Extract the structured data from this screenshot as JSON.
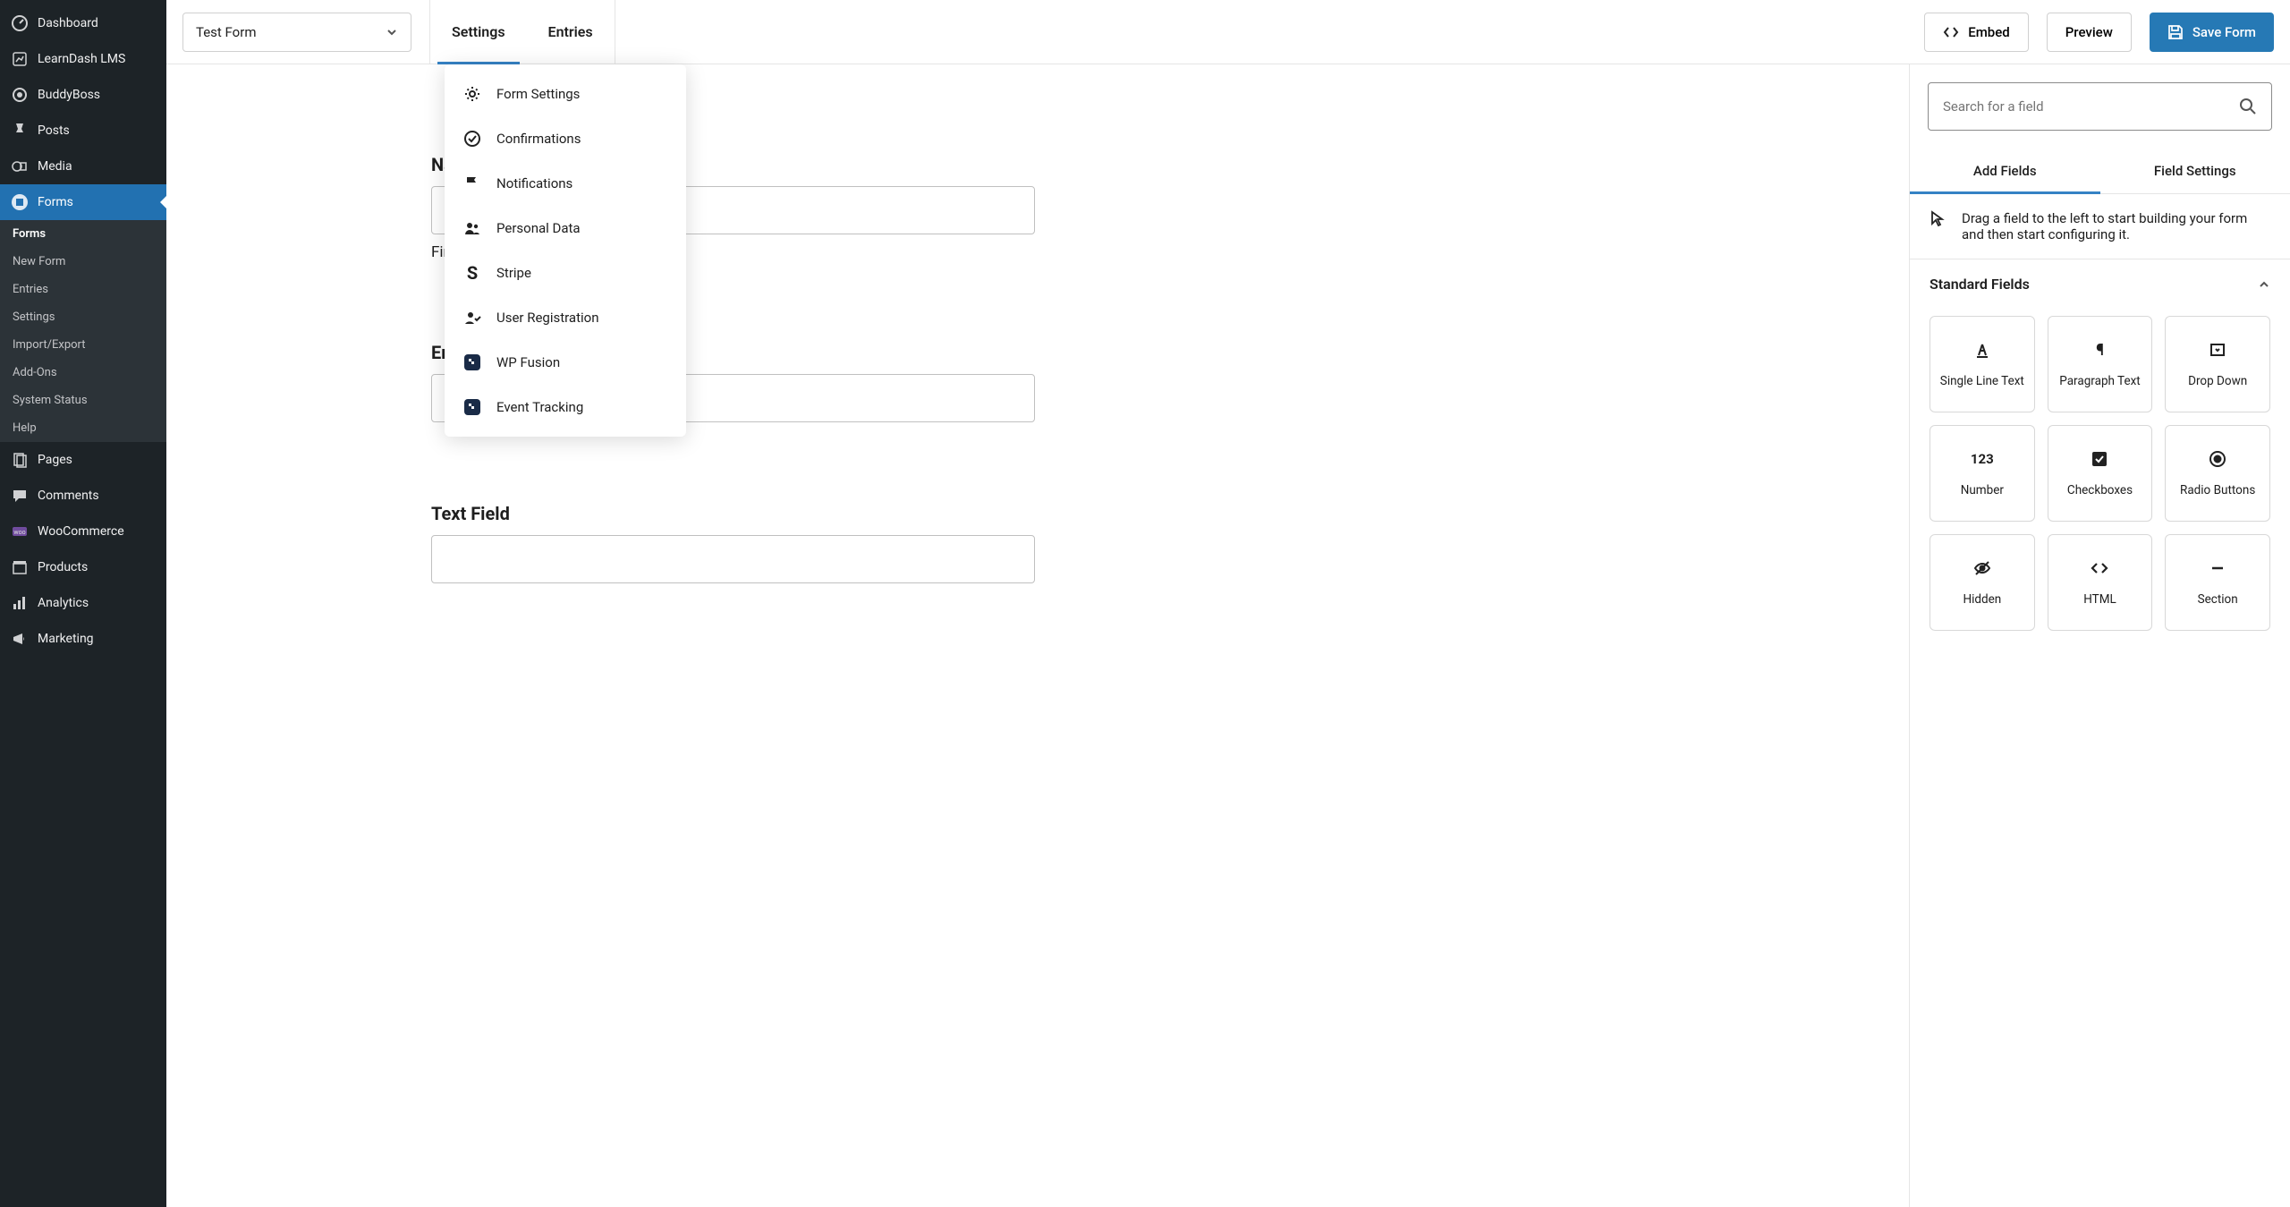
{
  "sidebar": {
    "items": [
      {
        "label": "Dashboard",
        "icon": "dashboard"
      },
      {
        "label": "LearnDash LMS",
        "icon": "learndash"
      },
      {
        "label": "BuddyBoss",
        "icon": "buddyboss"
      },
      {
        "label": "Posts",
        "icon": "pin"
      },
      {
        "label": "Media",
        "icon": "media"
      },
      {
        "label": "Forms",
        "icon": "forms",
        "active": true
      },
      {
        "label": "Pages",
        "icon": "pages"
      },
      {
        "label": "Comments",
        "icon": "comments"
      },
      {
        "label": "WooCommerce",
        "icon": "woo"
      },
      {
        "label": "Products",
        "icon": "products"
      },
      {
        "label": "Analytics",
        "icon": "analytics"
      },
      {
        "label": "Marketing",
        "icon": "marketing"
      }
    ],
    "sub": [
      {
        "label": "Forms",
        "current": true
      },
      {
        "label": "New Form"
      },
      {
        "label": "Entries"
      },
      {
        "label": "Settings"
      },
      {
        "label": "Import/Export"
      },
      {
        "label": "Add-Ons"
      },
      {
        "label": "System Status"
      },
      {
        "label": "Help"
      }
    ]
  },
  "topbar": {
    "form_name": "Test Form",
    "tabs": [
      {
        "label": "Settings",
        "active": true
      },
      {
        "label": "Entries"
      }
    ],
    "embed": "Embed",
    "preview": "Preview",
    "save": "Save Form"
  },
  "dropdown": {
    "items": [
      {
        "label": "Form Settings",
        "icon": "gear"
      },
      {
        "label": "Confirmations",
        "icon": "check-circle"
      },
      {
        "label": "Notifications",
        "icon": "flag"
      },
      {
        "label": "Personal Data",
        "icon": "users"
      },
      {
        "label": "Stripe",
        "icon": "stripe"
      },
      {
        "label": "User Registration",
        "icon": "user-check"
      },
      {
        "label": "WP Fusion",
        "icon": "wpfusion"
      },
      {
        "label": "Event Tracking",
        "icon": "wpfusion"
      }
    ]
  },
  "form": {
    "fields": [
      {
        "label": "Name",
        "sub": "First"
      },
      {
        "label": "Email"
      },
      {
        "label": "Text Field"
      }
    ]
  },
  "rightpanel": {
    "search_placeholder": "Search for a field",
    "tabs": [
      {
        "label": "Add Fields",
        "active": true
      },
      {
        "label": "Field Settings"
      }
    ],
    "hint": "Drag a field to the left to start building your form and then start configuring it.",
    "section_title": "Standard Fields",
    "tiles": [
      {
        "label": "Single Line Text",
        "icon": "text"
      },
      {
        "label": "Paragraph Text",
        "icon": "paragraph"
      },
      {
        "label": "Drop Down",
        "icon": "dropdown"
      },
      {
        "label": "Number",
        "icon": "number"
      },
      {
        "label": "Checkboxes",
        "icon": "checkbox"
      },
      {
        "label": "Radio Buttons",
        "icon": "radio"
      },
      {
        "label": "Hidden",
        "icon": "hidden"
      },
      {
        "label": "HTML",
        "icon": "html"
      },
      {
        "label": "Section",
        "icon": "section"
      }
    ]
  }
}
